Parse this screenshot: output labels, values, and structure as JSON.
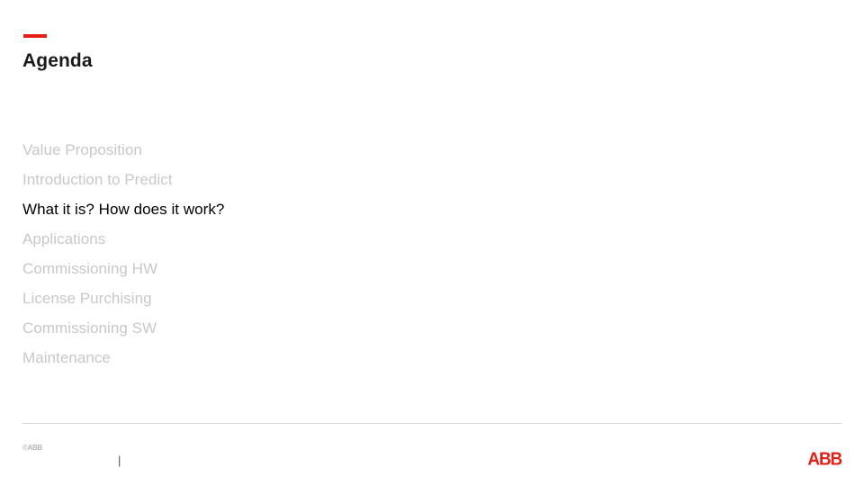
{
  "slide": {
    "title": "Agenda",
    "accent_color": "#e32119",
    "muted_color": "#c8c8c8",
    "active_color": "#000000",
    "agenda_items": [
      {
        "label": "Value Proposition",
        "active": false
      },
      {
        "label": "Introduction to Predict",
        "active": false
      },
      {
        "label": "What it is? How does it work?",
        "active": true
      },
      {
        "label": "Applications",
        "active": false
      },
      {
        "label": "Commissioning HW",
        "active": false
      },
      {
        "label": "License Purchising",
        "active": false
      },
      {
        "label": "Commissioning SW",
        "active": false
      },
      {
        "label": "Maintenance",
        "active": false
      }
    ],
    "footer": {
      "left_text": "©ABB",
      "divider": "|",
      "note": "",
      "logo": "ABB"
    }
  }
}
